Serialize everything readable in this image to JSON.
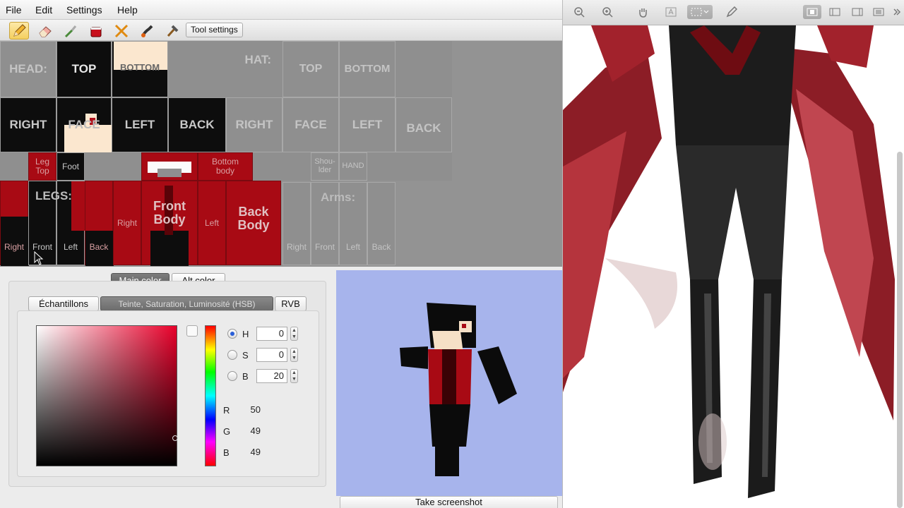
{
  "menu": {
    "file": "File",
    "edit": "Edit",
    "settings": "Settings",
    "help": "Help"
  },
  "toolbar": {
    "tool_settings_label": "Tool settings"
  },
  "skin": {
    "head_label": "HEAD:",
    "hat_label": "HAT:",
    "top": "TOP",
    "bottom": "BOTTOM",
    "right": "RIGHT",
    "face": "FACE",
    "left": "LEFT",
    "back": "BACK",
    "leg_top": "Leg Top",
    "foot": "Foot",
    "bottom_body": "Bottom body",
    "shoulder": "Shou- lder",
    "hand": "HAND",
    "legs_label": "LEGS:",
    "arms_label": "Arms:",
    "right_small": "Right",
    "front_small": "Front",
    "left_small": "Left",
    "back_small": "Back",
    "front_body": "Front Body",
    "back_body": "Back Body"
  },
  "color": {
    "main_color": "Main color",
    "alt_color": "Alt color",
    "tab_swatches": "Échantillons",
    "tab_hsb": "Teinte, Saturation, Luminosité (HSB)",
    "tab_rgb": "RVB",
    "h_label": "H",
    "s_label": "S",
    "b_label": "B",
    "h_value": "0",
    "s_value": "0",
    "b_value": "20",
    "r_label": "R",
    "g_label": "G",
    "b2_label": "B",
    "r_value": "50",
    "g_value": "49",
    "b2_value": "49"
  },
  "preview": {
    "screenshot_label": "Take screenshot"
  },
  "colors": {
    "skin_red": "#a80a14",
    "preview_bg": "#a7b4ec",
    "hsb_hue": "#e8002a"
  }
}
